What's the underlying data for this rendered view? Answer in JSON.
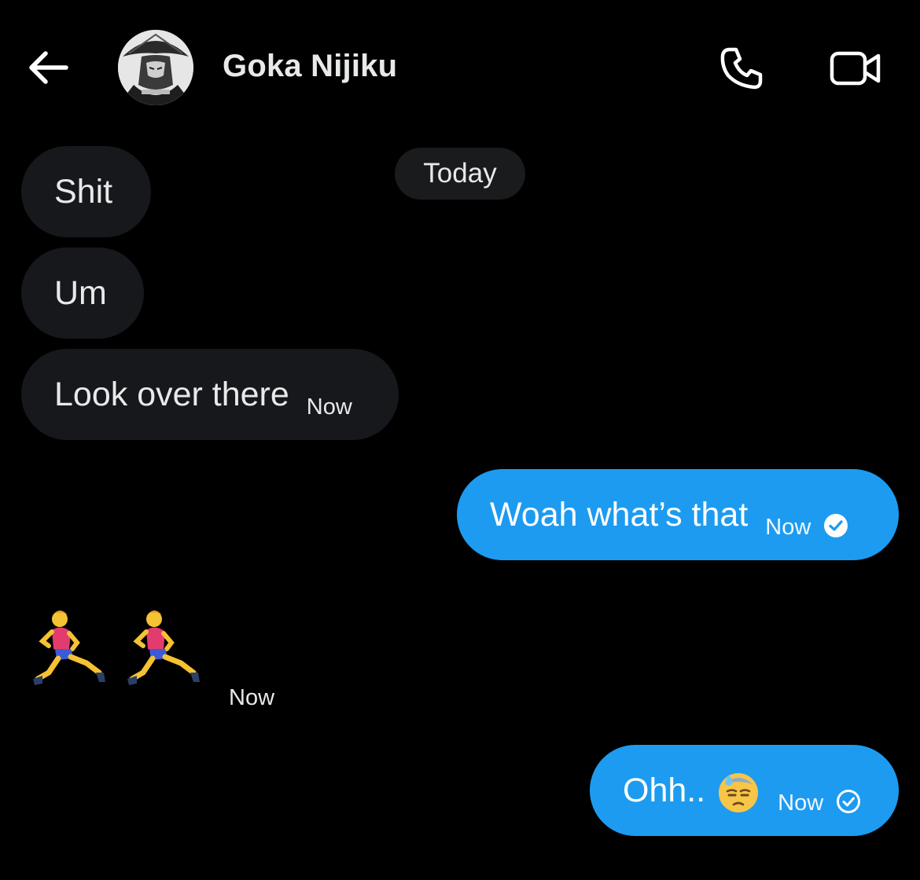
{
  "header": {
    "back_icon": "arrow-left-icon",
    "contact_name": "Goka Nijiku",
    "call_icon": "phone-icon",
    "video_icon": "video-camera-icon"
  },
  "date_separator": "Today",
  "messages": [
    {
      "direction": "incoming",
      "text": "Shit",
      "time": ""
    },
    {
      "direction": "incoming",
      "text": "Um",
      "time": ""
    },
    {
      "direction": "incoming",
      "text": "Look over there",
      "time": "Now"
    },
    {
      "direction": "outgoing",
      "text": "Woah what’s that",
      "time": "Now",
      "status": "seen"
    },
    {
      "direction": "incoming",
      "text": "",
      "emoji": [
        "man-running-emoji",
        "man-running-emoji"
      ],
      "time": "Now"
    },
    {
      "direction": "outgoing",
      "text": "Ohh..",
      "emoji": [
        "downcast-face-with-sweat-emoji"
      ],
      "time": "Now",
      "status": "sent"
    }
  ],
  "colors": {
    "background": "#000000",
    "incoming_bubble": "#16181c",
    "outgoing_bubble": "#1d9bf0",
    "text": "#e7e9ea"
  }
}
